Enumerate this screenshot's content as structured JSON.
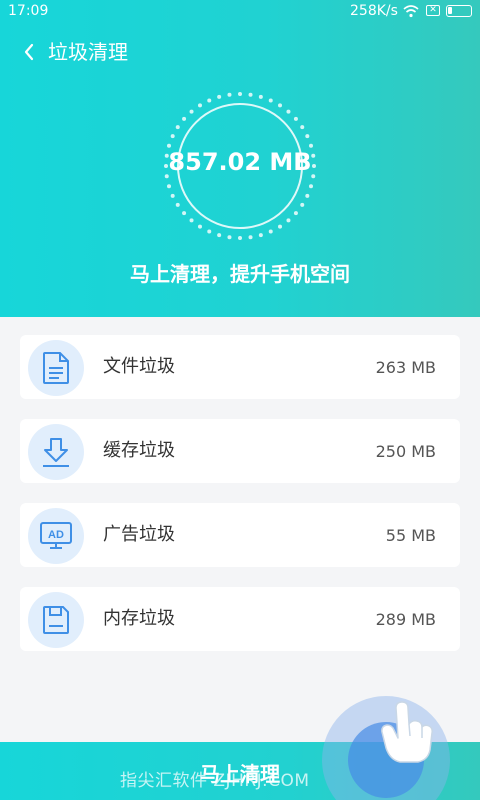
{
  "status_bar": {
    "time": "17:09",
    "speed": "258K/s",
    "icons": [
      "wifi-icon",
      "sim-x-icon",
      "battery-icon"
    ]
  },
  "header": {
    "back_icon": "chevron-left-icon",
    "title": "垃圾清理"
  },
  "summary": {
    "total_size": "857.02 MB",
    "subtitle": "马上清理，提升手机空间"
  },
  "categories": [
    {
      "icon": "document-icon",
      "label": "文件垃圾",
      "size": "263 MB"
    },
    {
      "icon": "download-icon",
      "label": "缓存垃圾",
      "size": "250 MB"
    },
    {
      "icon": "ad-icon",
      "label": "广告垃圾",
      "size": "55 MB"
    },
    {
      "icon": "storage-icon",
      "label": "内存垃圾",
      "size": "289 MB"
    }
  ],
  "action": {
    "clean_label": "马上清理"
  },
  "watermark": "指尖汇软件 ZJHRJ.COM",
  "colors": {
    "accent": "#1ed4d4",
    "icon_blue": "#3f8fe6",
    "icon_bg": "#e1eefc"
  }
}
